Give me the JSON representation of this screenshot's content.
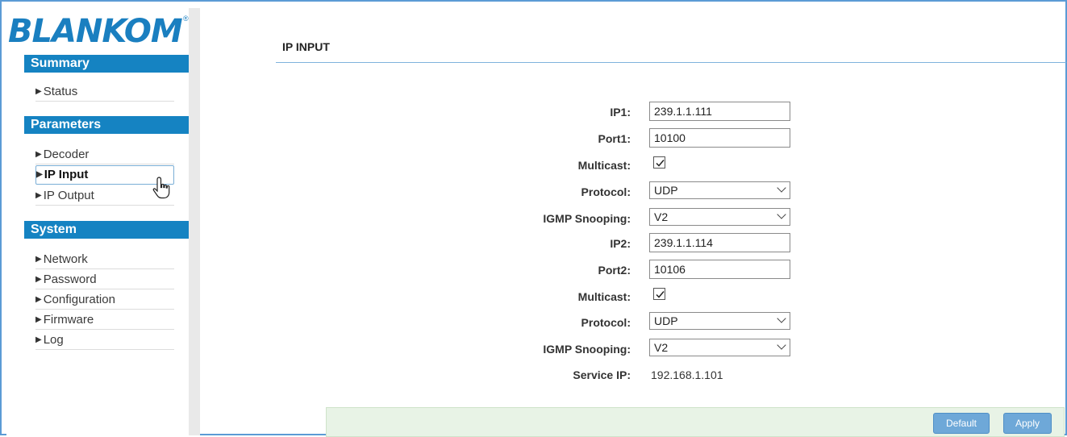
{
  "brand": {
    "name": "BLANKOM",
    "reg": "®"
  },
  "sidebar": {
    "sections": [
      {
        "title": "Summary",
        "items": [
          {
            "label": "Status"
          }
        ]
      },
      {
        "title": "Parameters",
        "items": [
          {
            "label": "Decoder"
          },
          {
            "label": "IP Input"
          },
          {
            "label": "IP Output"
          }
        ]
      },
      {
        "title": "System",
        "items": [
          {
            "label": "Network"
          },
          {
            "label": "Password"
          },
          {
            "label": "Configuration"
          },
          {
            "label": "Firmware"
          },
          {
            "label": "Log"
          }
        ]
      }
    ],
    "active_item": "IP Input"
  },
  "main": {
    "title": "IP INPUT",
    "form": {
      "ip1": {
        "label": "IP1:",
        "value": "239.1.1.111"
      },
      "port1": {
        "label": "Port1:",
        "value": "10100"
      },
      "multicast1": {
        "label": "Multicast:",
        "checked": true
      },
      "protocol1": {
        "label": "Protocol:",
        "value": "UDP"
      },
      "igmp1": {
        "label": "IGMP Snooping:",
        "value": "V2"
      },
      "ip2": {
        "label": "IP2:",
        "value": "239.1.1.114"
      },
      "port2": {
        "label": "Port2:",
        "value": "10106"
      },
      "multicast2": {
        "label": "Multicast:",
        "checked": true
      },
      "protocol2": {
        "label": "Protocol:",
        "value": "UDP"
      },
      "igmp2": {
        "label": "IGMP Snooping:",
        "value": "V2"
      },
      "service_ip": {
        "label": "Service IP:",
        "value": "192.168.1.101"
      }
    },
    "buttons": {
      "default": "Default",
      "apply": "Apply"
    }
  },
  "colors": {
    "accent": "#1583c2",
    "footer": "#e8f3e6",
    "button": "#6ea8d8"
  }
}
